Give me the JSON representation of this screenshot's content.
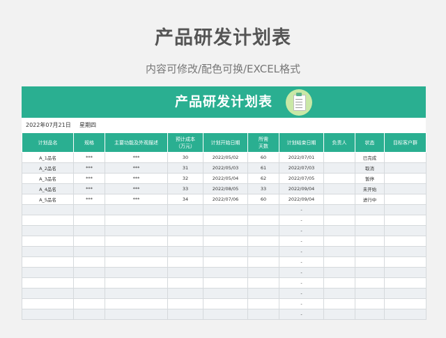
{
  "title": "产品研发计划表",
  "subtitle": "内容可修改/配色可换/EXCEL格式",
  "sheet": {
    "banner_title": "产品研发计划表",
    "date": "2022年07月21日",
    "weekday": "星期四",
    "headers": [
      "计划品名",
      "规格",
      "主要功能及外观描述",
      "预计成本\n（万元）",
      "计划开始日期",
      "所需\n天数",
      "计划结束日期",
      "负责人",
      "状态",
      "目标客户群"
    ],
    "rows": [
      [
        "A_1品名",
        "***",
        "***",
        "30",
        "2022/05/02",
        "60",
        "2022/07/01",
        "",
        "已完成",
        ""
      ],
      [
        "A_2品名",
        "***",
        "***",
        "31",
        "2022/05/03",
        "61",
        "2022/07/03",
        "",
        "取消",
        ""
      ],
      [
        "A_3品名",
        "***",
        "***",
        "32",
        "2022/05/04",
        "62",
        "2022/07/05",
        "",
        "暂停",
        ""
      ],
      [
        "A_4品名",
        "***",
        "***",
        "33",
        "2022/08/05",
        "33",
        "2022/09/04",
        "",
        "未开始",
        ""
      ],
      [
        "A_5品名",
        "***",
        "***",
        "34",
        "2022/07/06",
        "60",
        "2022/09/04",
        "",
        "进行中",
        ""
      ],
      [
        "",
        "",
        "",
        "",
        "",
        "",
        "-",
        "",
        "",
        ""
      ],
      [
        "",
        "",
        "",
        "",
        "",
        "",
        "-",
        "",
        "",
        ""
      ],
      [
        "",
        "",
        "",
        "",
        "",
        "",
        "-",
        "",
        "",
        ""
      ],
      [
        "",
        "",
        "",
        "",
        "",
        "",
        "-",
        "",
        "",
        ""
      ],
      [
        "",
        "",
        "",
        "",
        "",
        "",
        "-",
        "",
        "",
        ""
      ],
      [
        "",
        "",
        "",
        "",
        "",
        "",
        "-",
        "",
        "",
        ""
      ],
      [
        "",
        "",
        "",
        "",
        "",
        "",
        "-",
        "",
        "",
        ""
      ],
      [
        "",
        "",
        "",
        "",
        "",
        "",
        "-",
        "",
        "",
        ""
      ],
      [
        "",
        "",
        "",
        "",
        "",
        "",
        "-",
        "",
        "",
        ""
      ],
      [
        "",
        "",
        "",
        "",
        "",
        "",
        "-",
        "",
        "",
        ""
      ],
      [
        "",
        "",
        "",
        "",
        "",
        "",
        "-",
        "",
        "",
        ""
      ]
    ]
  },
  "colors": {
    "accent": "#2aaf91",
    "alt_row": "#edf0f3",
    "icon_bg": "#c9e8a6"
  },
  "icons": {
    "banner_icon": "clipboard-icon"
  }
}
